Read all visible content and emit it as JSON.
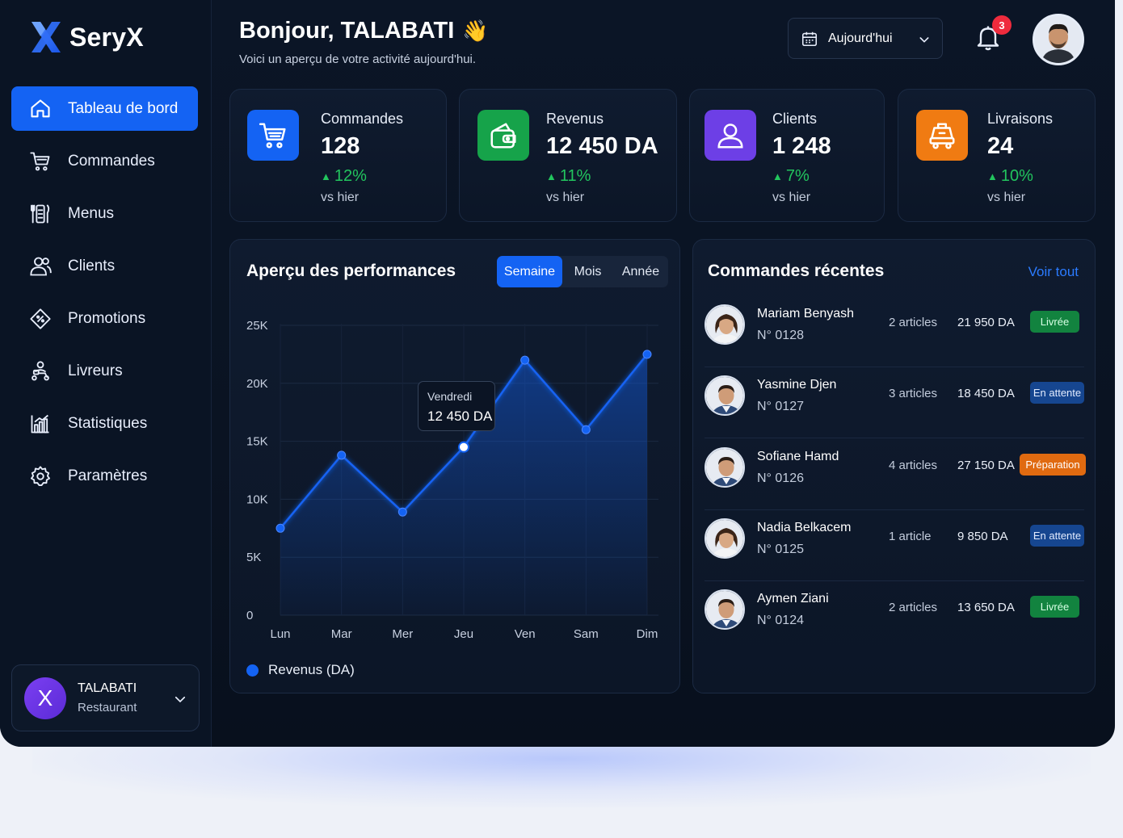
{
  "app": {
    "name": "SeryX"
  },
  "sidebar": {
    "items": [
      {
        "label": "Tableau de bord",
        "icon": "home-icon",
        "active": true
      },
      {
        "label": "Commandes",
        "icon": "cart-icon"
      },
      {
        "label": "Menus",
        "icon": "menu-icon"
      },
      {
        "label": "Clients",
        "icon": "users-icon"
      },
      {
        "label": "Promotions",
        "icon": "tag-icon"
      },
      {
        "label": "Livreurs",
        "icon": "scooter-icon"
      },
      {
        "label": "Statistiques",
        "icon": "chart-icon"
      },
      {
        "label": "Paramètres",
        "icon": "gear-icon"
      }
    ],
    "user": {
      "initial": "X",
      "name": "TALABATI",
      "role": "Restaurant"
    }
  },
  "header": {
    "greeting": "Bonjour, TALABATI",
    "emoji": "👋",
    "subtitle": "Voici un aperçu de votre activité aujourd'hui.",
    "date_filter": "Aujourd'hui",
    "notifications": "3"
  },
  "stats": [
    {
      "label": "Commandes",
      "value": "128",
      "delta": "12%",
      "sub": "vs hier",
      "color": "#1463f3",
      "icon": "cart-icon"
    },
    {
      "label": "Revenus",
      "value": "12 450 DA",
      "delta": "11%",
      "sub": "vs hier",
      "color": "#16a34a",
      "icon": "wallet-icon"
    },
    {
      "label": "Clients",
      "value": "1 248",
      "delta": "7%",
      "sub": "vs hier",
      "color": "#6d3fe6",
      "icon": "user-icon"
    },
    {
      "label": "Livraisons",
      "value": "24",
      "delta": "10%",
      "sub": "vs hier",
      "color": "#f07b12",
      "icon": "delivery-icon"
    }
  ],
  "performance": {
    "title": "Aperçu des performances",
    "tabs": [
      {
        "label": "Semaine",
        "active": true
      },
      {
        "label": "Mois"
      },
      {
        "label": "Année"
      }
    ],
    "tooltip": {
      "day": "Vendredi",
      "value": "12 450 DA"
    }
  },
  "chart_data": {
    "type": "area",
    "categories": [
      "Lun",
      "Mar",
      "Mer",
      "Jeu",
      "Ven",
      "Sam",
      "Dim"
    ],
    "series": [
      {
        "name": "Revenus (DA)",
        "values": [
          7500,
          13800,
          8900,
          14500,
          22000,
          16000,
          22500
        ]
      }
    ],
    "yticks": [
      "0",
      "5K",
      "10K",
      "15K",
      "20K",
      "25K"
    ],
    "ylim": [
      0,
      25000
    ],
    "highlight_index": 3,
    "grid": true,
    "legend": "bottom-left",
    "color": "#1463f3"
  },
  "orders": {
    "title": "Commandes récentes",
    "see_all": "Voir tout",
    "rows": [
      {
        "name": "Mariam Benyash",
        "num": "N° 0128",
        "qty": "2 articles",
        "amount": "21 950 DA",
        "status": "Livrée",
        "status_type": "livree",
        "avatar": "female"
      },
      {
        "name": "Yasmine Djen",
        "num": "N° 0127",
        "qty": "3 articles",
        "amount": "18 450 DA",
        "status": "En attente",
        "status_type": "attente",
        "avatar": "male"
      },
      {
        "name": "Sofiane Hamd",
        "num": "N° 0126",
        "qty": "4 articles",
        "amount": "27 150 DA",
        "status": "Préparation",
        "status_type": "prep",
        "avatar": "male"
      },
      {
        "name": "Nadia Belkacem",
        "num": "N° 0125",
        "qty": "1 article",
        "amount": "9 850 DA",
        "status": "En attente",
        "status_type": "attente",
        "avatar": "female"
      },
      {
        "name": "Aymen Ziani",
        "num": "N° 0124",
        "qty": "2 articles",
        "amount": "13 650 DA",
        "status": "Livrée",
        "status_type": "livree",
        "avatar": "male"
      }
    ]
  }
}
